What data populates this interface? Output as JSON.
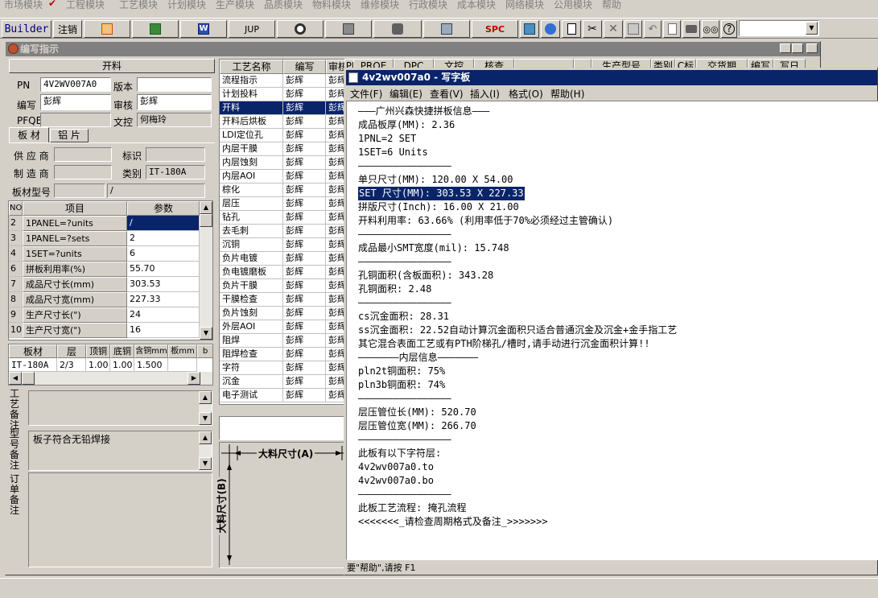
{
  "menu": [
    "市场模块",
    "工程模块",
    "工艺模块",
    "计划模块",
    "生产模块",
    "品质模块",
    "物料模块",
    "维修模块",
    "行政模块",
    "成本模块",
    "网络模块",
    "公用模块",
    "帮助"
  ],
  "toolbar": {
    "builder": "Builder",
    "logout": "注销",
    "jup": "JUP",
    "spc": "SPC"
  },
  "mdi": {
    "title": "编写指示",
    "section": "开料",
    "pn_label": "PN",
    "pn_value": "4V2WV007A0",
    "version_label": "版本",
    "version_value": "",
    "writer_label": "编写",
    "writer_value": "彭辉",
    "reviewer_label": "审核",
    "reviewer_value": "彭辉",
    "pfqe_label": "PFQE",
    "pfqe_value": "",
    "doccontrol_label": "文控",
    "doccontrol_value": "何梅玲",
    "tabs": [
      "板 材",
      "铝 片"
    ],
    "supplier_label": "供 应 商",
    "supplier_value": "",
    "mark_label": "标识",
    "mark_value": "",
    "maker_label": "制 造 商",
    "maker_value": "",
    "category_label": "类别",
    "category_value": "IT-180A",
    "model_label": "板材型号",
    "model_value": "",
    "model_value2": "/"
  },
  "param_grid": {
    "headers": [
      "NO",
      "项目",
      "参数"
    ],
    "rows": [
      {
        "no": "2",
        "item": "1PANEL=?units",
        "val": "/"
      },
      {
        "no": "3",
        "item": "1PANEL=?sets",
        "val": "2"
      },
      {
        "no": "4",
        "item": "1SET=?units",
        "val": "6"
      },
      {
        "no": "6",
        "item": "拼板利用率(%)",
        "val": "55.70"
      },
      {
        "no": "7",
        "item": "成品尺寸长(mm)",
        "val": "303.53"
      },
      {
        "no": "8",
        "item": "成品尺寸宽(mm)",
        "val": "227.33"
      },
      {
        "no": "9",
        "item": "生产尺寸长(\")",
        "val": "24"
      },
      {
        "no": "10",
        "item": "生产尺寸宽(\")",
        "val": "16"
      }
    ]
  },
  "material_grid": {
    "headers": [
      "板材",
      "层",
      "顶铜",
      "底铜",
      "含铜mm",
      "板mm",
      "b"
    ],
    "rows": [
      [
        "IT-180A",
        "2/3",
        "1.00",
        "1.00",
        "1.500",
        "",
        ""
      ]
    ]
  },
  "remarks": {
    "process_label": "工艺备注",
    "process_value": "",
    "model_label": "型号备注",
    "model_value": "板子符合无铅焊接",
    "order_label": "订单备注",
    "order_value": ""
  },
  "process_grid": {
    "headers": [
      "工艺名称",
      "编写",
      "审核",
      "PRQE",
      "DPC",
      "文控",
      "核查",
      "",
      "",
      "生产型号",
      "类别",
      "C标",
      "交货期",
      "编写",
      "写日"
    ],
    "rows": [
      {
        "name": "流程指示",
        "writer": "彭辉",
        "rev": "彭辉"
      },
      {
        "name": "计划投料",
        "writer": "彭辉",
        "rev": "彭辉"
      },
      {
        "name": "开料",
        "writer": "彭辉",
        "rev": "彭辉"
      },
      {
        "name": "开料后烘板",
        "writer": "彭辉",
        "rev": "彭辉"
      },
      {
        "name": "LDI定位孔",
        "writer": "彭辉",
        "rev": "彭辉"
      },
      {
        "name": "内层干膜",
        "writer": "彭辉",
        "rev": "彭辉"
      },
      {
        "name": "内层蚀刻",
        "writer": "彭辉",
        "rev": "彭辉"
      },
      {
        "name": "内层AOI",
        "writer": "彭辉",
        "rev": "彭辉"
      },
      {
        "name": "棕化",
        "writer": "彭辉",
        "rev": "彭辉"
      },
      {
        "name": "层压",
        "writer": "彭辉",
        "rev": "彭辉"
      },
      {
        "name": "钻孔",
        "writer": "彭辉",
        "rev": "彭辉"
      },
      {
        "name": "去毛刺",
        "writer": "彭辉",
        "rev": "彭辉"
      },
      {
        "name": "沉铜",
        "writer": "彭辉",
        "rev": "彭辉"
      },
      {
        "name": "负片电镀",
        "writer": "彭辉",
        "rev": "彭辉"
      },
      {
        "name": "负电镀磨板",
        "writer": "彭辉",
        "rev": "彭辉"
      },
      {
        "name": "负片干膜",
        "writer": "彭辉",
        "rev": "彭辉"
      },
      {
        "name": "干膜检查",
        "writer": "彭辉",
        "rev": "彭辉"
      },
      {
        "name": "负片蚀刻",
        "writer": "彭辉",
        "rev": "彭辉"
      },
      {
        "name": "外层AOI",
        "writer": "彭辉",
        "rev": "彭辉"
      },
      {
        "name": "阻焊",
        "writer": "彭辉",
        "rev": "彭辉"
      },
      {
        "name": "阻焊检查",
        "writer": "彭辉",
        "rev": "彭辉"
      },
      {
        "name": "字符",
        "writer": "彭辉",
        "rev": "彭辉"
      },
      {
        "name": "沉金",
        "writer": "彭辉",
        "rev": "彭辉"
      },
      {
        "name": "电子测试",
        "writer": "彭辉",
        "rev": "彭辉"
      }
    ]
  },
  "diagram": {
    "width_label": "大料尺寸(A)",
    "height_label": "大料尺寸(B)"
  },
  "notepad": {
    "title": "4v2wv007a0 - 写字板",
    "menu": [
      "文件(F)",
      "编辑(E)",
      "查看(V)",
      "插入(I)",
      "格式(O)",
      "帮助(H)"
    ],
    "lines": [
      "———广州兴森快捷拼板信息———",
      "成品板厚(MM): 2.36",
      "1PNL=2 SET",
      "1SET=6 Units",
      "————————————————",
      "单只尺寸(MM): 120.00 X 54.00",
      "SET 尺寸(MM): 303.53 X 227.33",
      "拼版尺寸(Inch): 16.00 X 21.00",
      "开料利用率: 63.66% (利用率低于70%必须经过主管确认)",
      "————————————————",
      "成品最小SMT宽度(mil): 15.748",
      "————————————————",
      "孔铜面积(含板面积): 343.28",
      "孔铜面积: 2.48",
      "————————————————",
      "cs沉金面积: 28.31",
      "ss沉金面积: 22.52自动计算沉金面积只适合普通沉金及沉金+金手指工艺",
      "其它混合表面工艺或有PTH阶梯孔/槽时,请手动进行沉金面积计算!!",
      "———————内层信息———————",
      "pln2t铜面积: 75%",
      "pln3b铜面积: 74%",
      "————————————————",
      "层压管位长(MM): 520.70",
      "层压管位宽(MM): 266.70",
      "————————————————",
      "此板有以下字符层:",
      "4v2wv007a0.to",
      "4v2wv007a0.bo",
      "————————————————",
      "此板工艺流程: 掩孔流程",
      "<<<<<<<_请检查周期格式及备注_>>>>>>>"
    ],
    "status": "要\"帮助\",请按 F1"
  }
}
